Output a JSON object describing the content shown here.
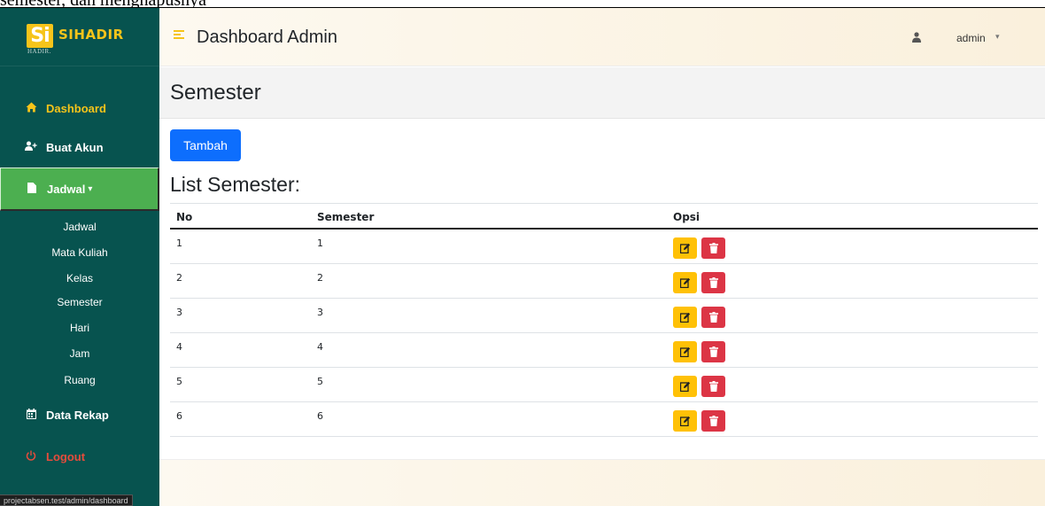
{
  "caption": "semester, dan menghapusnya",
  "brand": {
    "logo_text": "Si",
    "logo_sub": "HADIR.",
    "name": "SIHADIR"
  },
  "header": {
    "title": "Dashboard Admin",
    "user": "admin"
  },
  "sidebar": {
    "items": [
      {
        "label": "Dashboard",
        "icon": "home-icon"
      },
      {
        "label": "Buat Akun",
        "icon": "user-plus-icon"
      },
      {
        "label": "Jadwal",
        "icon": "file-icon"
      },
      {
        "label": "Data Rekap",
        "icon": "calendar-icon"
      },
      {
        "label": "Logout",
        "icon": "power-icon"
      }
    ],
    "jadwal_caret": "▾",
    "subitems": [
      "Jadwal",
      "Mata Kuliah",
      "Kelas",
      "Semester",
      "Hari",
      "Jam",
      "Ruang"
    ]
  },
  "page": {
    "title": "Semester",
    "add_button": "Tambah",
    "list_title": "List Semester:"
  },
  "table": {
    "headers": [
      "No",
      "Semester",
      "Opsi"
    ],
    "rows": [
      {
        "no": "1",
        "semester": "1"
      },
      {
        "no": "2",
        "semester": "2"
      },
      {
        "no": "3",
        "semester": "3"
      },
      {
        "no": "4",
        "semester": "4"
      },
      {
        "no": "5",
        "semester": "5"
      },
      {
        "no": "6",
        "semester": "6"
      }
    ]
  },
  "status_url": "projectabsen.test/admin/dashboard",
  "colors": {
    "sidebar": "#07534f",
    "active": "#4caf50",
    "brand_yellow": "#f6c41a",
    "primary": "#0d6efd",
    "warning": "#ffc107",
    "danger": "#dc3545",
    "logout": "#e74c3c"
  }
}
